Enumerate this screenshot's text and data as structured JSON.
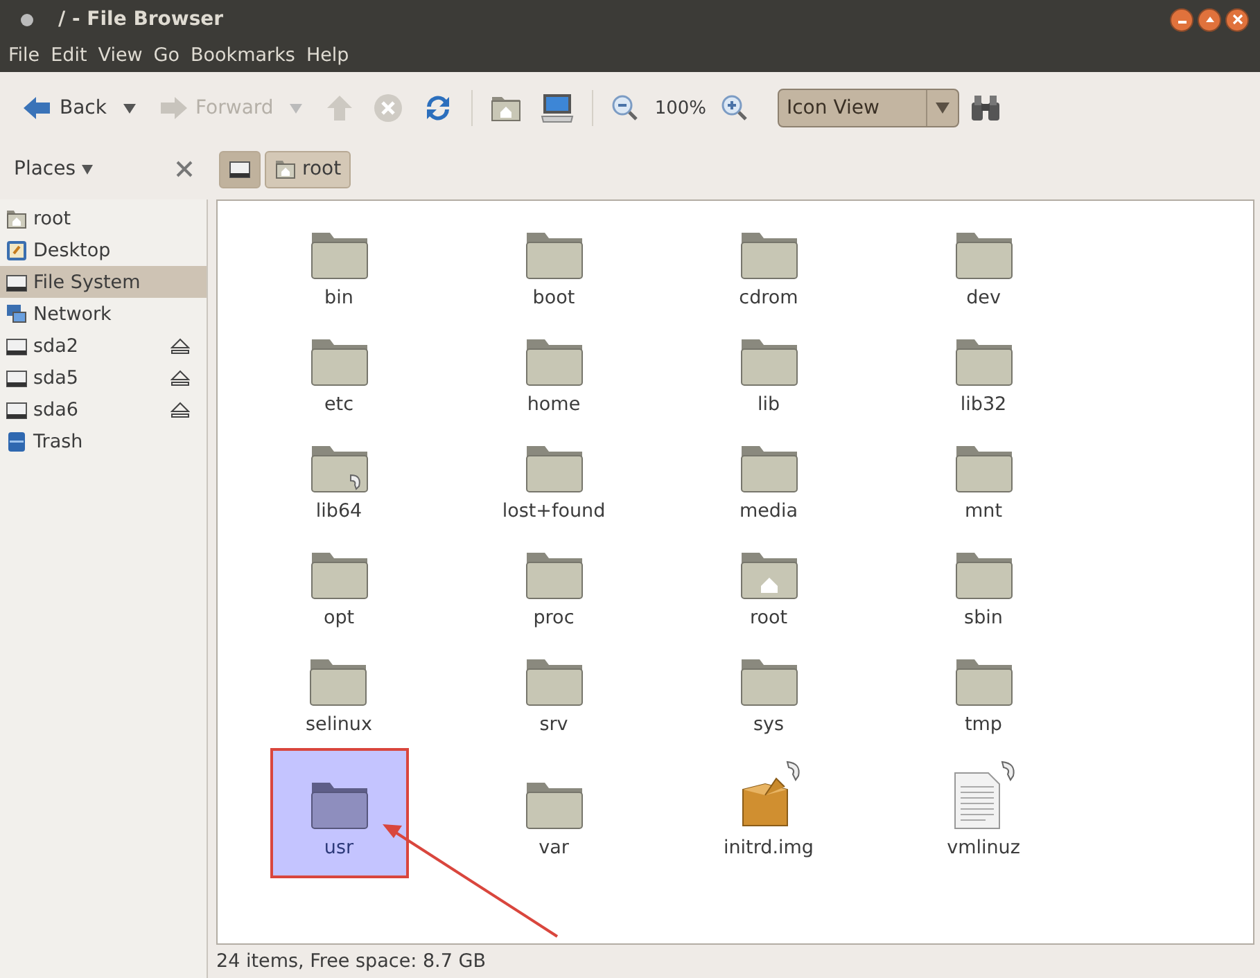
{
  "window": {
    "title": "/ - File Browser"
  },
  "menu": [
    "File",
    "Edit",
    "View",
    "Go",
    "Bookmarks",
    "Help"
  ],
  "toolbar": {
    "back": {
      "label": "Back",
      "disabled": false
    },
    "forward": {
      "label": "Forward",
      "disabled": true
    },
    "up": {
      "disabled": true
    },
    "stop": {
      "disabled": true
    },
    "zoom": "100%",
    "view": "Icon View"
  },
  "sidebar": {
    "title": "Places",
    "items": [
      {
        "kind": "home",
        "label": "root",
        "eject": false,
        "selected": false
      },
      {
        "kind": "desktop",
        "label": "Desktop",
        "eject": false,
        "selected": false
      },
      {
        "kind": "drive",
        "label": "File System",
        "eject": false,
        "selected": true
      },
      {
        "kind": "network",
        "label": "Network",
        "eject": false,
        "selected": false
      },
      {
        "kind": "drive",
        "label": "sda2",
        "eject": true,
        "selected": false
      },
      {
        "kind": "drive",
        "label": "sda5",
        "eject": true,
        "selected": false
      },
      {
        "kind": "drive",
        "label": "sda6",
        "eject": true,
        "selected": false
      },
      {
        "kind": "trash",
        "label": "Trash",
        "eject": false,
        "selected": false
      }
    ]
  },
  "breadcrumbs": [
    {
      "kind": "drive",
      "selected": true
    },
    {
      "kind": "home",
      "label": "root",
      "selected": false
    }
  ],
  "files": [
    {
      "kind": "folder",
      "name": "bin",
      "symlink": false,
      "selected": false
    },
    {
      "kind": "folder",
      "name": "boot",
      "symlink": false,
      "selected": false
    },
    {
      "kind": "folder",
      "name": "cdrom",
      "symlink": false,
      "selected": false
    },
    {
      "kind": "folder",
      "name": "dev",
      "symlink": false,
      "selected": false
    },
    {
      "kind": "folder",
      "name": "etc",
      "symlink": false,
      "selected": false
    },
    {
      "kind": "folder",
      "name": "home",
      "symlink": false,
      "selected": false
    },
    {
      "kind": "folder",
      "name": "lib",
      "symlink": false,
      "selected": false
    },
    {
      "kind": "folder",
      "name": "lib32",
      "symlink": false,
      "selected": false
    },
    {
      "kind": "folder",
      "name": "lib64",
      "symlink": true,
      "selected": false
    },
    {
      "kind": "folder",
      "name": "lost+found",
      "symlink": false,
      "selected": false
    },
    {
      "kind": "folder",
      "name": "media",
      "symlink": false,
      "selected": false
    },
    {
      "kind": "folder",
      "name": "mnt",
      "symlink": false,
      "selected": false
    },
    {
      "kind": "folder",
      "name": "opt",
      "symlink": false,
      "selected": false
    },
    {
      "kind": "folder",
      "name": "proc",
      "symlink": false,
      "selected": false
    },
    {
      "kind": "home-folder",
      "name": "root",
      "symlink": false,
      "selected": false
    },
    {
      "kind": "folder",
      "name": "sbin",
      "symlink": false,
      "selected": false
    },
    {
      "kind": "folder",
      "name": "selinux",
      "symlink": false,
      "selected": false
    },
    {
      "kind": "folder",
      "name": "srv",
      "symlink": false,
      "selected": false
    },
    {
      "kind": "folder",
      "name": "sys",
      "symlink": false,
      "selected": false
    },
    {
      "kind": "folder",
      "name": "tmp",
      "symlink": false,
      "selected": false
    },
    {
      "kind": "folder",
      "name": "usr",
      "symlink": false,
      "selected": true,
      "highlighted": true
    },
    {
      "kind": "folder",
      "name": "var",
      "symlink": false,
      "selected": false
    },
    {
      "kind": "package",
      "name": "initrd.img",
      "symlink": true,
      "selected": false
    },
    {
      "kind": "text",
      "name": "vmlinuz",
      "symlink": true,
      "selected": false
    }
  ],
  "status_bar": "24 items, Free space: 8.7 GB"
}
